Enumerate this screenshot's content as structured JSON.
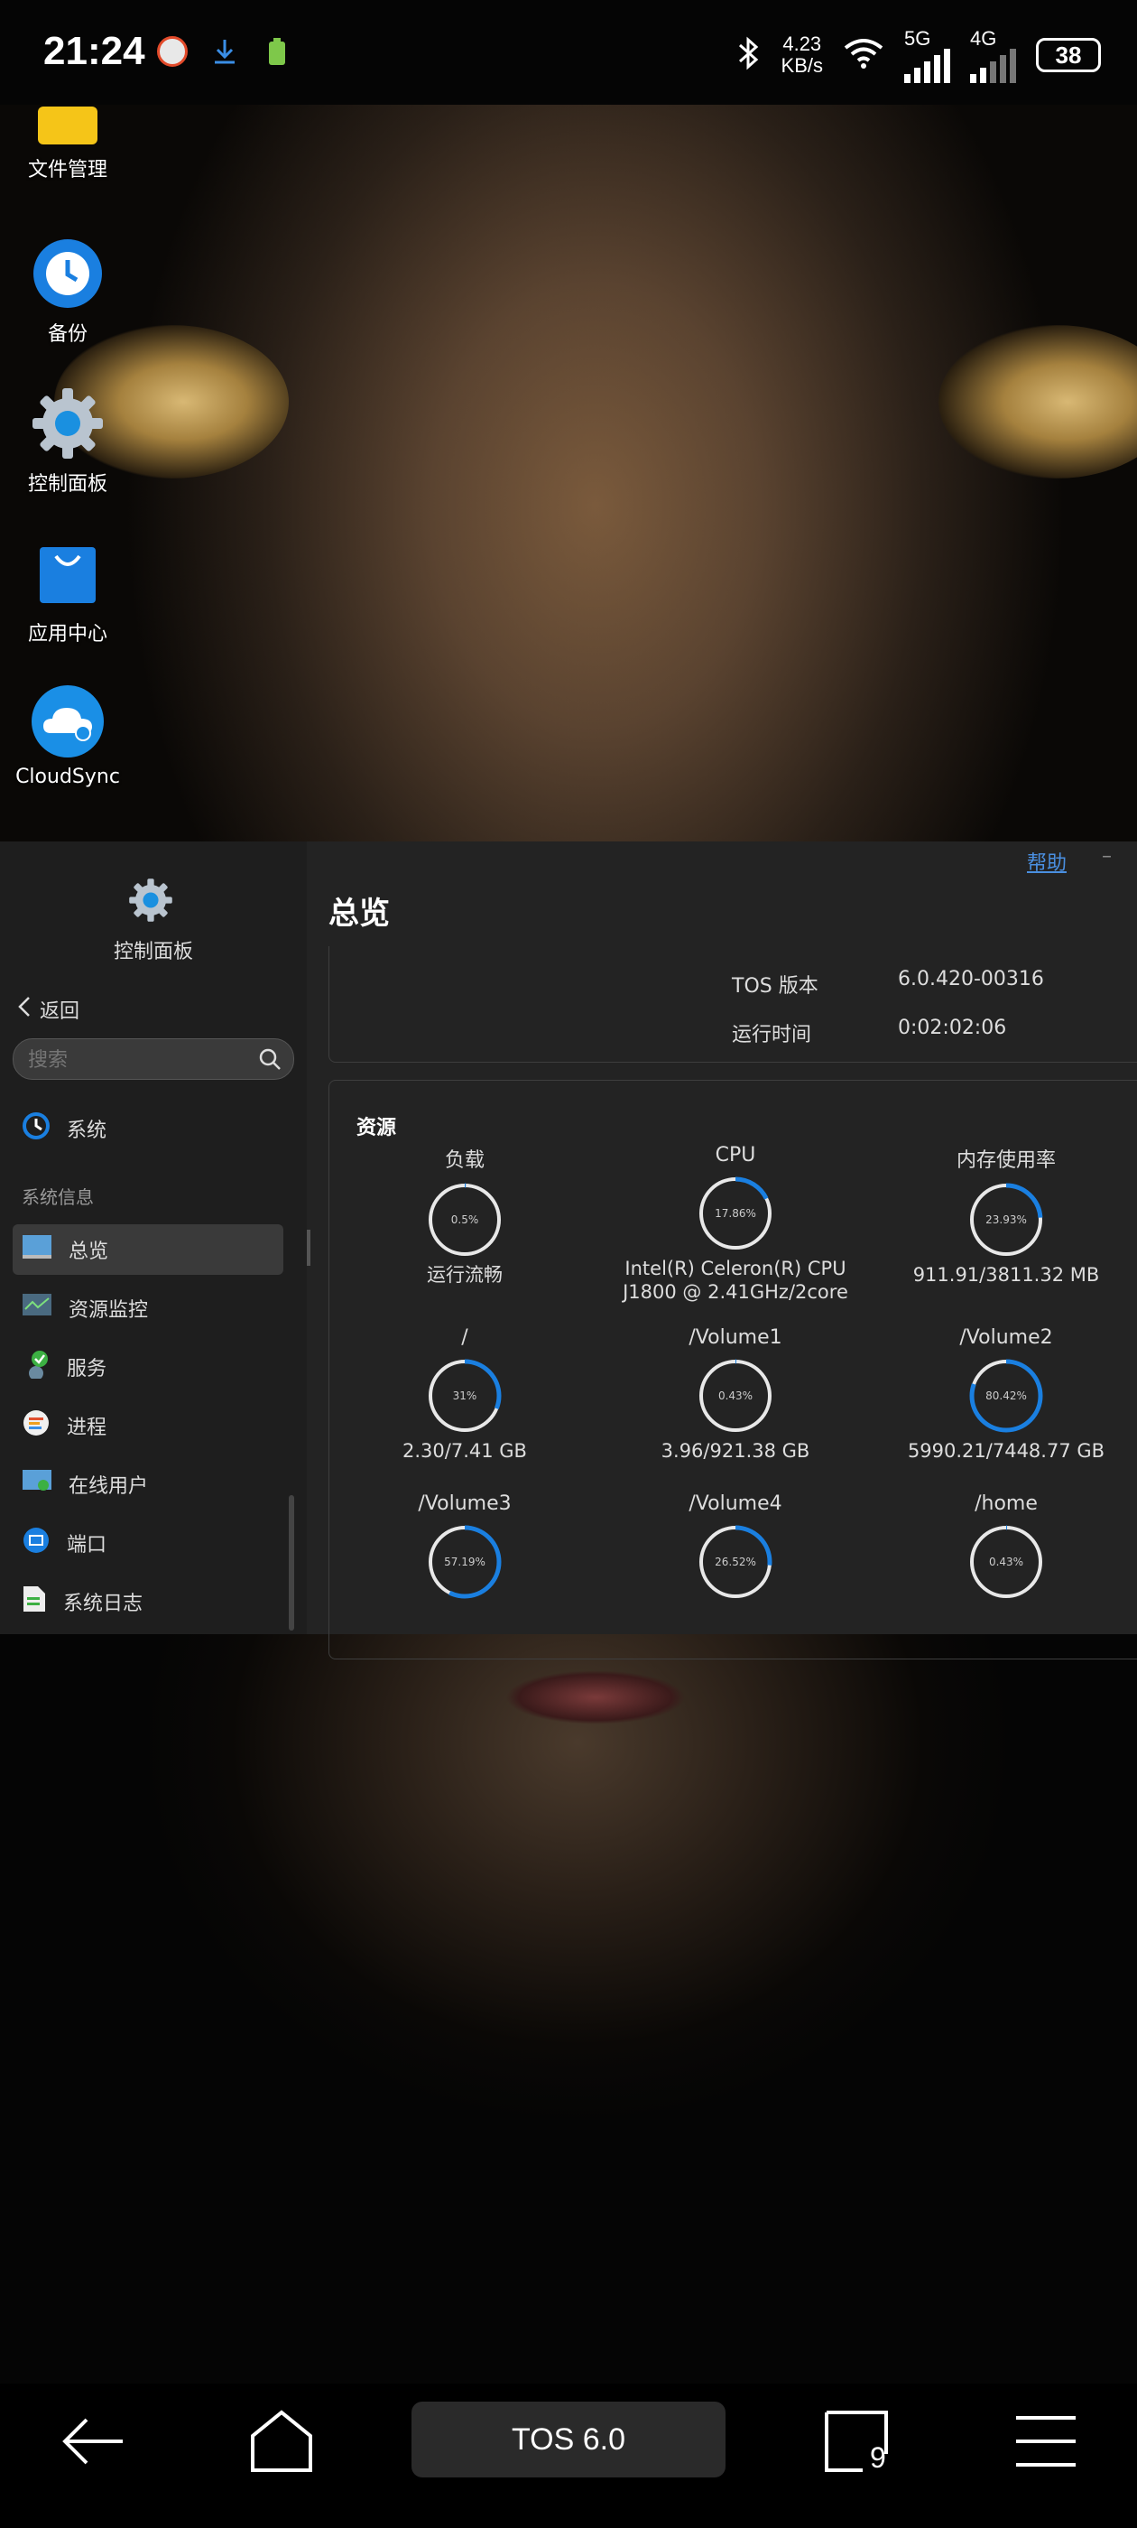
{
  "status_bar": {
    "time": "21:24",
    "speed_value": "4.23",
    "speed_unit": "KB/s",
    "net1": "5G",
    "net2": "4G",
    "battery": "38"
  },
  "desktop": {
    "icons": [
      {
        "label": "文件管理",
        "icon": "folder-icon"
      },
      {
        "label": "备份",
        "icon": "backup-icon"
      },
      {
        "label": "控制面板",
        "icon": "gear-icon"
      },
      {
        "label": "应用中心",
        "icon": "shopping-bag-icon"
      },
      {
        "label": "CloudSync",
        "icon": "cloud-sync-icon"
      }
    ]
  },
  "sidebar": {
    "title": "控制面板",
    "back": "返回",
    "search_placeholder": "搜索",
    "system": "系统",
    "section": "系统信息",
    "items": [
      {
        "label": "总览",
        "icon": "overview-icon"
      },
      {
        "label": "资源监控",
        "icon": "resource-monitor-icon"
      },
      {
        "label": "服务",
        "icon": "service-icon"
      },
      {
        "label": "进程",
        "icon": "process-icon"
      },
      {
        "label": "在线用户",
        "icon": "online-users-icon"
      },
      {
        "label": "端口",
        "icon": "port-icon"
      },
      {
        "label": "系统日志",
        "icon": "system-log-icon"
      }
    ]
  },
  "main": {
    "help": "帮助",
    "minimize": "–",
    "title": "总览",
    "tos_version_label": "TOS 版本",
    "tos_version_value": "6.0.420-00316",
    "uptime_label": "运行时间",
    "uptime_value": "0:02:02:06",
    "resources_title": "资源",
    "gauges": [
      {
        "label": "负载",
        "pct": "0.5%",
        "value": 0.5,
        "sub": "运行流畅"
      },
      {
        "label": "CPU",
        "pct": "17.86%",
        "value": 17.86,
        "sub": "Intel(R) Celeron(R) CPU J1800 @ 2.41GHz/2core"
      },
      {
        "label": "内存使用率",
        "pct": "23.93%",
        "value": 23.93,
        "sub": "911.91/3811.32 MB"
      },
      {
        "label": "/",
        "pct": "31%",
        "value": 31,
        "sub": "2.30/7.41 GB"
      },
      {
        "label": "/Volume1",
        "pct": "0.43%",
        "value": 0.43,
        "sub": "3.96/921.38 GB"
      },
      {
        "label": "/Volume2",
        "pct": "80.42%",
        "value": 80.42,
        "sub": "5990.21/7448.77 GB"
      },
      {
        "label": "/Volume3",
        "pct": "57.19%",
        "value": 57.19,
        "sub": ""
      },
      {
        "label": "/Volume4",
        "pct": "26.52%",
        "value": 26.52,
        "sub": ""
      },
      {
        "label": "/home",
        "pct": "0.43%",
        "value": 0.43,
        "sub": ""
      }
    ]
  },
  "bottom_nav": {
    "center": "TOS 6.0",
    "recent_count": "9"
  },
  "colors": {
    "accent": "#1a7fe0",
    "panel_bg": "#232323",
    "sidebar_bg": "#1e1e1e"
  }
}
